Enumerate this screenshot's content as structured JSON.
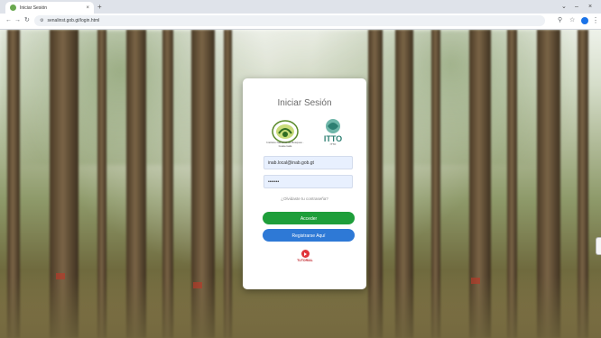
{
  "browser": {
    "tab_title": "Iniciar Sesión",
    "new_tab": "+",
    "window_controls": {
      "caret": "⌄",
      "minimize": "–",
      "close": "×"
    },
    "url": "senalinst.gob.gt/login.html",
    "nav": {
      "back": "←",
      "forward": "→",
      "reload": "↻"
    }
  },
  "login": {
    "title": "Iniciar Sesión",
    "logo_a_caption": "Instituto Nacional de Bosques · Guatemala",
    "logo_b_caption": "ITTO",
    "logo_b_mark": "ITTO",
    "username_value": "inab.local@inab.gob.gt",
    "password_value": "•••••••",
    "forgot_link": "¿Olvidaste tu contraseña?",
    "login_button": "Acceder",
    "aux_button": "Registrarse Aquí",
    "tutorial_label": "TUTORIAL"
  },
  "colors": {
    "accent_green": "#1e9e3a",
    "accent_blue": "#2e79d6",
    "youtube_red": "#e0343b"
  }
}
